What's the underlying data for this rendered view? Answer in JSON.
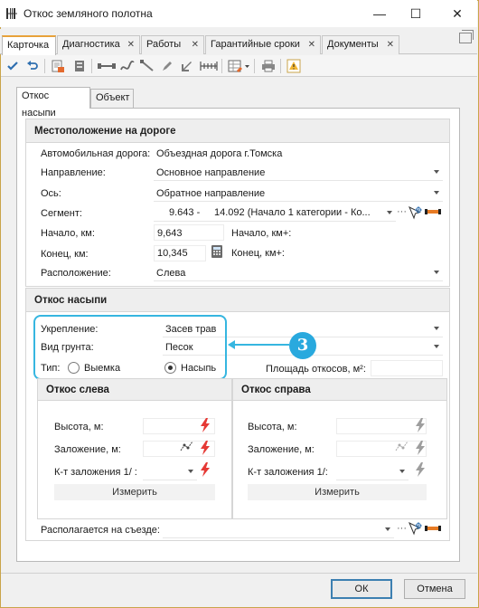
{
  "window": {
    "title": "Откос земляного полотна",
    "minimize": "—",
    "maximize": "☐",
    "close": "✕"
  },
  "doc_tabs": [
    {
      "label": "Карточка",
      "active": true,
      "closable": false
    },
    {
      "label": "Диагностика",
      "active": false,
      "closable": true
    },
    {
      "label": "Работы",
      "active": false,
      "closable": true
    },
    {
      "label": "Гарантийные сроки",
      "active": false,
      "closable": true
    },
    {
      "label": "Документы",
      "active": false,
      "closable": true
    }
  ],
  "toolbar_icons": [
    "check-icon",
    "undo-icon",
    "report-icon",
    "archive-icon",
    "segment-tool-icon",
    "curve-tool-icon",
    "angle-tool-icon",
    "pencil-icon",
    "move-icon",
    "ruler-icon",
    "table-settings-icon",
    "print-icon",
    "warning-icon"
  ],
  "inner_tabs": {
    "slope": "Откос насыпи",
    "object": "Объект"
  },
  "location": {
    "heading": "Местоположение на дороге",
    "road_label": "Автомобильная дорога:",
    "road_value": "Объездная дорога г.Томска",
    "direction_label": "Направление:",
    "direction_value": "Основное направление",
    "axis_label": "Ось:",
    "axis_value": "Обратное направление",
    "segment_label": "Сегмент:",
    "segment_start": "9.643 -",
    "segment_value": "14.092 (Начало 1 категории - Ко...",
    "segment_more": "···",
    "start_label": "Начало, км:",
    "start_value": "9,643",
    "start_kmplus_label": "Начало, км+:",
    "end_label": "Конец, км:",
    "end_value": "10,345",
    "end_kmplus_label": "Конец, км+:",
    "position_label": "Расположение:",
    "position_value": "Слева"
  },
  "slope": {
    "heading": "Откос насыпи",
    "reinforcement_label": "Укрепление:",
    "reinforcement_value": "Засев трав",
    "soil_label": "Вид грунта:",
    "soil_value": "Песок",
    "type_label": "Тип:",
    "type_options": [
      "Выемка",
      "Насыпь"
    ],
    "type_selected": "Насыпь",
    "area_label": "Площадь откосов, м²:",
    "callout_number": "3"
  },
  "left_slope": {
    "heading": "Откос слева",
    "height_label": "Высота, м:",
    "laying_label": "Заложение, м:",
    "coef_label": "К-т заложения 1/ :",
    "measure": "Измерить"
  },
  "right_slope": {
    "heading": "Откос справа",
    "height_label": "Высота, м:",
    "laying_label": "Заложение, м:",
    "coef_label": "К-т заложения 1/:",
    "measure": "Измерить"
  },
  "exit": {
    "label": "Располагается на съезде:",
    "more": "···"
  },
  "footer": {
    "ok": "ОК",
    "cancel": "Отмена"
  },
  "colors": {
    "accent_tab": "#e8a23a",
    "callout": "#36b6e0",
    "lightning_active": "#e53935",
    "lightning_inactive": "#9e9e9e"
  }
}
